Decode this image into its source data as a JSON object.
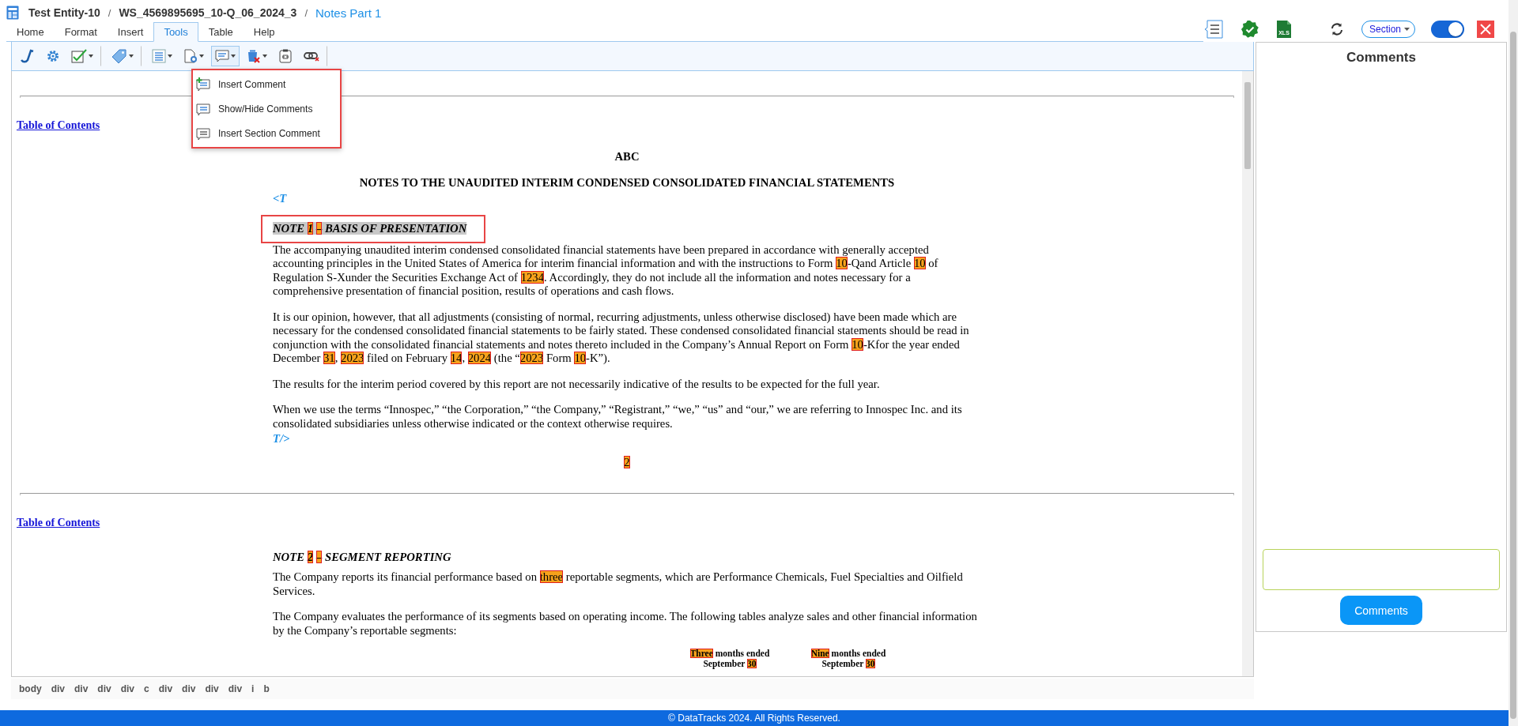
{
  "breadcrumb": {
    "separator": "/",
    "items": [
      {
        "label": "Test Entity-10",
        "current": false
      },
      {
        "label": "WS_4569895695_10-Q_06_2024_3",
        "current": false
      },
      {
        "label": "Notes Part 1",
        "current": true
      }
    ]
  },
  "tabs": [
    {
      "label": "Home",
      "selected": false
    },
    {
      "label": "Format",
      "selected": false
    },
    {
      "label": "Insert",
      "selected": false
    },
    {
      "label": "Tools",
      "selected": true
    },
    {
      "label": "Table",
      "selected": false
    },
    {
      "label": "Help",
      "selected": false
    }
  ],
  "header_actions": {
    "xls_label": "XLS",
    "section_filter": "Section",
    "toggle_on": true
  },
  "toolbar": [
    {
      "kind": "hook",
      "dropdown": false,
      "active": false,
      "separator_after": false
    },
    {
      "kind": "gear",
      "dropdown": false,
      "active": false,
      "separator_after": false
    },
    {
      "kind": "checkbox",
      "dropdown": true,
      "active": false,
      "separator_after": true
    },
    {
      "kind": "tag",
      "dropdown": true,
      "active": false,
      "separator_after": true
    },
    {
      "kind": "list",
      "dropdown": true,
      "active": false,
      "separator_after": false
    },
    {
      "kind": "document-gear",
      "dropdown": true,
      "active": false,
      "separator_after": false
    },
    {
      "kind": "comment",
      "dropdown": true,
      "active": true,
      "separator_after": false
    },
    {
      "kind": "trash",
      "dropdown": true,
      "active": false,
      "separator_after": false
    },
    {
      "kind": "clipboard-link",
      "dropdown": false,
      "active": false,
      "separator_after": false
    },
    {
      "kind": "unlink",
      "dropdown": false,
      "active": false,
      "separator_after": true
    }
  ],
  "comment_menu": [
    {
      "kind": "add",
      "label": "Insert Comment"
    },
    {
      "kind": "show",
      "label": "Show/Hide Comments"
    },
    {
      "kind": "section",
      "label": "Insert Section Comment"
    }
  ],
  "document": [
    {
      "kind": "rule"
    },
    {
      "kind": "toc_link",
      "text": "Table of Contents"
    },
    {
      "kind": "title",
      "text": "ABC"
    },
    {
      "kind": "title",
      "text": "NOTES TO THE UNAUDITED INTERIM CONDENSED CONSOLIDATED FINANCIAL STATEMENTS"
    },
    {
      "kind": "marker",
      "text": "<T"
    },
    {
      "kind": "note_heading",
      "selected": true,
      "parts": [
        {
          "text": "NOTE ",
          "tagged": false
        },
        {
          "text": "1",
          "tagged": true
        },
        {
          "text": "–",
          "tagged": true
        },
        {
          "text": " BASIS OF PRESENTATION",
          "tagged": false
        }
      ]
    },
    {
      "kind": "paragraph",
      "parts": [
        {
          "text": "The accompanying unaudited interim condensed consolidated financial statements have been prepared in accordance with generally accepted accounting principles in the United States of America for interim financial information and with the instructions to Form ",
          "tagged": false
        },
        {
          "text": "10",
          "tagged": true
        },
        {
          "text": "-Qand Article ",
          "tagged": false
        },
        {
          "text": "10",
          "tagged": true
        },
        {
          "text": " of Regulation S-Xunder the Securities Exchange Act of ",
          "tagged": false
        },
        {
          "text": "1234",
          "tagged": true
        },
        {
          "text": ". Accordingly, they do not include all the information and notes necessary for a comprehensive presentation of financial position, results of operations and cash flows.",
          "tagged": false
        }
      ]
    },
    {
      "kind": "paragraph",
      "parts": [
        {
          "text": "It is our opinion, however, that all adjustments (consisting of normal, recurring adjustments, unless otherwise disclosed) have been made which are necessary for the condensed consolidated financial statements to be fairly stated. These condensed consolidated financial statements should be read in conjunction with the consolidated financial statements and notes thereto included in the Company’s Annual Report on Form ",
          "tagged": false
        },
        {
          "text": "10",
          "tagged": true
        },
        {
          "text": "-Kfor the year ended December ",
          "tagged": false
        },
        {
          "text": "31",
          "tagged": true
        },
        {
          "text": ", ",
          "tagged": false
        },
        {
          "text": "2023",
          "tagged": true
        },
        {
          "text": " filed on February ",
          "tagged": false
        },
        {
          "text": "14",
          "tagged": true
        },
        {
          "text": ", ",
          "tagged": false
        },
        {
          "text": "2024",
          "tagged": true
        },
        {
          "text": " (the “",
          "tagged": false
        },
        {
          "text": "2023",
          "tagged": true
        },
        {
          "text": " Form ",
          "tagged": false
        },
        {
          "text": "10",
          "tagged": true
        },
        {
          "text": "-K”).",
          "tagged": false
        }
      ]
    },
    {
      "kind": "paragraph",
      "parts": [
        {
          "text": "The results for the interim period covered by this report are not necessarily indicative of the results to be expected for the full year.",
          "tagged": false
        }
      ]
    },
    {
      "kind": "paragraph",
      "parts": [
        {
          "text": "When we use the terms “Innospec,” “the Corporation,” “the Company,” “Registrant,” “we,” “us” and “our,” we are referring to Innospec Inc. and its consolidated subsidiaries unless otherwise indicated or the context otherwise requires.",
          "tagged": false
        }
      ]
    },
    {
      "kind": "marker",
      "text": "T/>"
    },
    {
      "kind": "page_number",
      "text": "2"
    },
    {
      "kind": "rule"
    },
    {
      "kind": "toc_link",
      "text": "Table of Contents"
    },
    {
      "kind": "note_heading",
      "selected": false,
      "parts": [
        {
          "text": "NOTE ",
          "tagged": false
        },
        {
          "text": "2",
          "tagged": true
        },
        {
          "text": "–",
          "tagged": true
        },
        {
          "text": " SEGMENT REPORTING",
          "tagged": false
        }
      ]
    },
    {
      "kind": "paragraph",
      "parts": [
        {
          "text": "The Company reports its financial performance based on ",
          "tagged": false
        },
        {
          "text": "three",
          "tagged": true
        },
        {
          "text": " reportable segments, which are Performance Chemicals, Fuel Specialties and Oilfield Services.",
          "tagged": false
        }
      ]
    },
    {
      "kind": "paragraph",
      "parts": [
        {
          "text": "The Company evaluates the performance of its segments based on operating income. The following tables analyze sales and other financial information by the Company’s reportable segments:",
          "tagged": false
        }
      ]
    },
    {
      "kind": "table_header",
      "columns": [
        [
          [
            {
              "text": "Three",
              "tagged": true
            },
            {
              "text": " months ended",
              "tagged": false
            }
          ],
          [
            {
              "text": "September ",
              "tagged": false
            },
            {
              "text": "30",
              "tagged": true
            }
          ]
        ],
        [
          [
            {
              "text": "Nine",
              "tagged": true
            },
            {
              "text": " months ended",
              "tagged": false
            }
          ],
          [
            {
              "text": "September ",
              "tagged": false
            },
            {
              "text": "30",
              "tagged": true
            }
          ]
        ]
      ]
    }
  ],
  "element_path": [
    "body",
    "div",
    "div",
    "div",
    "div",
    "c",
    "div",
    "div",
    "div",
    "div",
    "i",
    "b"
  ],
  "comments_panel": {
    "title": "Comments",
    "button": "Comments"
  },
  "footer": "© DataTracks 2024. All Rights Reserved."
}
